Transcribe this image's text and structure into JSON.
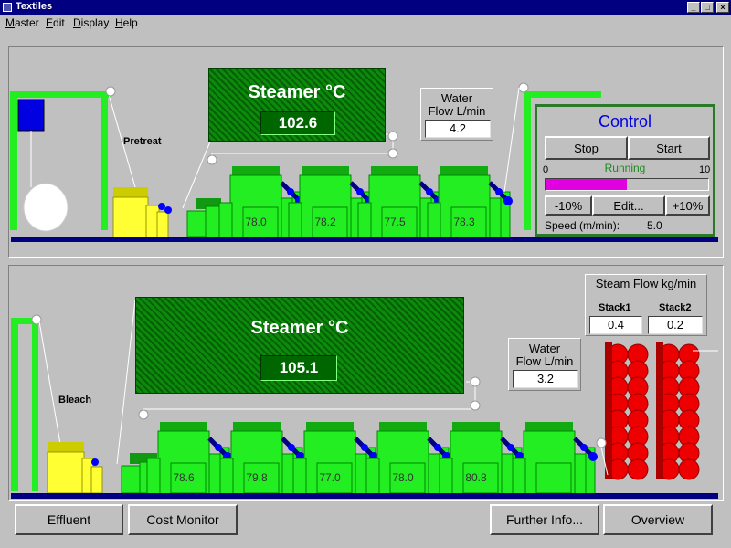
{
  "window": {
    "title": "Textiles"
  },
  "menu": [
    "Master",
    "Edit",
    "Display",
    "Help"
  ],
  "top": {
    "stage_label": "Pretreat",
    "steamer": {
      "title": "Steamer °C",
      "value": "102.6"
    },
    "water_flow": {
      "title_line1": "Water",
      "title_line2": "Flow L/min",
      "value": "4.2"
    },
    "tank_values": [
      "78.0",
      "78.2",
      "77.5",
      "78.3"
    ],
    "control": {
      "title": "Control",
      "stop_label": "Stop",
      "start_label": "Start",
      "scale_min": "0",
      "scale_max": "10",
      "status": "Running",
      "speed_fraction": 0.5,
      "minus_label": "-10%",
      "edit_label": "Edit...",
      "plus_label": "+10%",
      "speed_label": "Speed (m/min):",
      "speed_value": "5.0"
    }
  },
  "bottom": {
    "stage_label": "Bleach",
    "steamer": {
      "title": "Steamer °C",
      "value": "105.1"
    },
    "water_flow": {
      "title_line1": "Water",
      "title_line2": "Flow L/min",
      "value": "3.2"
    },
    "steam_flow": {
      "title": "Steam Flow kg/min",
      "stack1_label": "Stack1",
      "stack2_label": "Stack2",
      "stack1_value": "0.4",
      "stack2_value": "0.2"
    },
    "tank_values": [
      "78.6",
      "79.8",
      "77.0",
      "78.0",
      "80.8",
      ""
    ]
  },
  "buttons": {
    "effluent": "Effluent",
    "cost_monitor": "Cost Monitor",
    "further_info": "Further Info...",
    "overview": "Overview"
  },
  "colors": {
    "machine_green": "#22ee22",
    "conveyor": "#000080",
    "stack_red": "#ee0000",
    "accent": "#e000e0"
  }
}
